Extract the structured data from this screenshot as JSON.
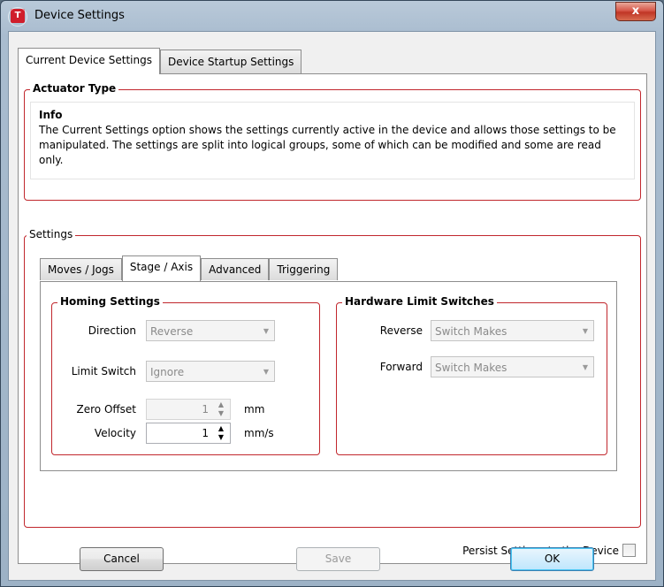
{
  "window": {
    "title": "Device Settings",
    "close_glyph": "x",
    "app_icon_letter": "T",
    "icon": "thorlabs-app-icon"
  },
  "tabs": [
    {
      "label": "Current Device Settings",
      "active": true
    },
    {
      "label": "Device Startup Settings",
      "active": false
    }
  ],
  "actuator": {
    "legend": "Actuator Type",
    "info_title": "Info",
    "info_text": "The Current Settings option shows the settings currently active in the device and allows those settings to be manipulated. The settings are split into logical groups, some of which can be modified and some are read only."
  },
  "settings": {
    "legend": "Settings",
    "tabs": [
      {
        "label": "Moves / Jogs",
        "active": false
      },
      {
        "label": "Stage / Axis",
        "active": true
      },
      {
        "label": "Advanced",
        "active": false
      },
      {
        "label": "Triggering",
        "active": false
      }
    ],
    "homing": {
      "legend": "Homing Settings",
      "direction_label": "Direction",
      "direction_value": "Reverse",
      "limit_switch_label": "Limit Switch",
      "limit_switch_value": "Ignore",
      "zero_offset_label": "Zero Offset",
      "zero_offset_value": "1",
      "zero_offset_unit": "mm",
      "velocity_label": "Velocity",
      "velocity_value": "1",
      "velocity_unit": "mm/s"
    },
    "limits": {
      "legend": "Hardware Limit Switches",
      "reverse_label": "Reverse",
      "reverse_value": "Switch Makes",
      "forward_label": "Forward",
      "forward_value": "Switch Makes"
    },
    "persist_label": "Persist Settings to the Device",
    "persist_checked": false
  },
  "buttons": {
    "cancel": "Cancel",
    "save": "Save",
    "ok": "OK"
  },
  "colors": {
    "group_border": "#c1272d",
    "accent": "#3c7fb1"
  }
}
